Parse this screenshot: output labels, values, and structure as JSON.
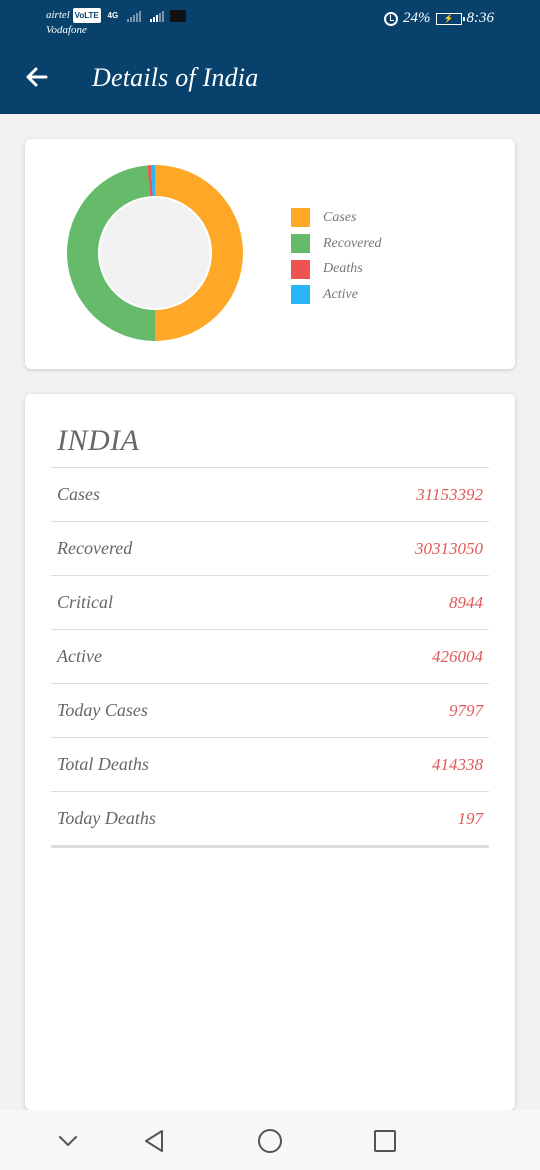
{
  "status_bar": {
    "carrier1": "airtel",
    "volte": "VoLTE",
    "net": "4G",
    "carrier2": "Vodafone",
    "battery": "24%",
    "time": "8:36"
  },
  "header": {
    "title": "Details of India",
    "color": "#08416b"
  },
  "chart_data": {
    "type": "pie",
    "donut": true,
    "categories": [
      "Cases",
      "Recovered",
      "Deaths",
      "Active"
    ],
    "values": [
      31153392,
      30313050,
      414338,
      426004
    ],
    "colors": [
      "#ffa726",
      "#66bb6a",
      "#ef5350",
      "#29b6f6"
    ]
  },
  "legend": [
    {
      "label": "Cases",
      "color": "#ffa726"
    },
    {
      "label": "Recovered",
      "color": "#66bb6a"
    },
    {
      "label": "Deaths",
      "color": "#ef5350"
    },
    {
      "label": "Active",
      "color": "#29b6f6"
    }
  ],
  "stats": {
    "country": "INDIA",
    "rows": [
      {
        "label": "Cases",
        "value": "31153392"
      },
      {
        "label": "Recovered",
        "value": "30313050"
      },
      {
        "label": "Critical",
        "value": "8944"
      },
      {
        "label": "Active",
        "value": "426004"
      },
      {
        "label": "Today Cases",
        "value": "9797"
      },
      {
        "label": "Total Deaths",
        "value": "414338"
      },
      {
        "label": "Today Deaths",
        "value": "197"
      }
    ]
  },
  "nav": {
    "icons": [
      "chevron-down-icon",
      "back-triangle-icon",
      "home-circle-icon",
      "recents-square-icon"
    ]
  }
}
